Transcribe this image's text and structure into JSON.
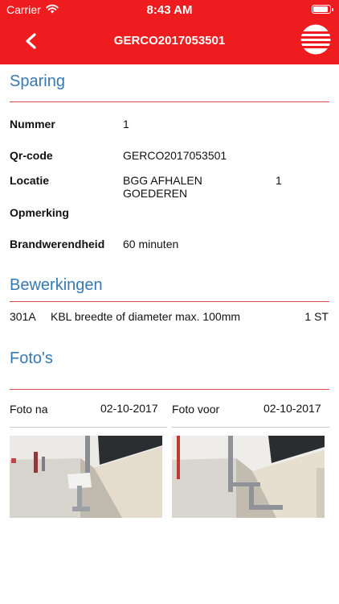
{
  "status": {
    "carrier": "Carrier",
    "time": "8:43 AM"
  },
  "nav": {
    "title": "GERCO2017053501"
  },
  "sparing": {
    "title": "Sparing",
    "fields": [
      {
        "label": "Nummer",
        "value": "1"
      },
      {
        "label": "Qr-code",
        "value": "GERCO2017053501"
      },
      {
        "label": "Locatie",
        "value_line1": "BGG AFHALEN",
        "value_line2": "GOEDEREN",
        "value_extra": "1"
      },
      {
        "label": "Opmerking",
        "value": ""
      },
      {
        "label": "Brandwerendheid",
        "value": "60 minuten"
      }
    ]
  },
  "bewerkingen": {
    "title": "Bewerkingen",
    "rows": [
      {
        "code": "301A",
        "description": "KBL breedte of diameter max. 100mm",
        "quantity": "1 ST"
      }
    ]
  },
  "fotos": {
    "title": "Foto's",
    "items": [
      {
        "label": "Foto na",
        "date": "02-10-2017"
      },
      {
        "label": "Foto voor",
        "date": "02-10-2017"
      }
    ]
  },
  "colors": {
    "brand": "#ee1c1f",
    "section_title": "#3779b3",
    "divider": "#e8474a"
  }
}
